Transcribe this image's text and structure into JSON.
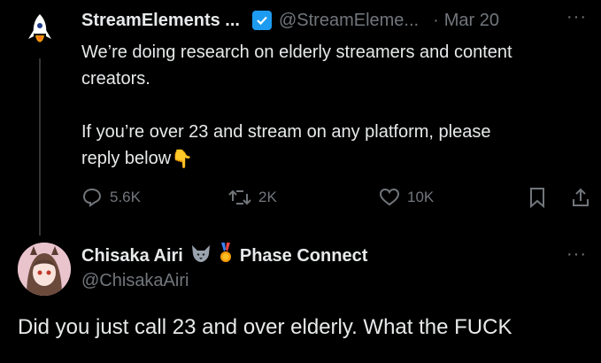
{
  "tweet": {
    "author_name": "StreamElements ...",
    "author_handle": "@StreamEleme...",
    "separator": "·",
    "date": "Mar 20",
    "more": "···",
    "line1": "We’re doing research on elderly streamers and content",
    "line2": "creators.",
    "line3": "If you’re over 23 and stream on any platform, please",
    "line4": "reply below",
    "line4_emoji": "👇",
    "replies": "5.6K",
    "retweets": "2K",
    "likes": "10K"
  },
  "reply": {
    "author_name": "Chisaka Airi",
    "badge_text": "Phase Connect",
    "author_handle": "@ChisakaAiri",
    "more": "···",
    "text": "Did you just call 23 and over elderly.  What the FUCK"
  },
  "colors": {
    "background": "#000000",
    "text": "#e7e9ea",
    "muted": "#71767b",
    "verified": "#1d9bf0"
  },
  "icons": [
    "rocket-logo-icon",
    "verified-badge-icon",
    "reply-icon",
    "retweet-icon",
    "like-icon",
    "bookmark-icon",
    "share-icon",
    "wolf-emoji-icon",
    "medal-emoji-icon",
    "point-down-emoji-icon"
  ]
}
